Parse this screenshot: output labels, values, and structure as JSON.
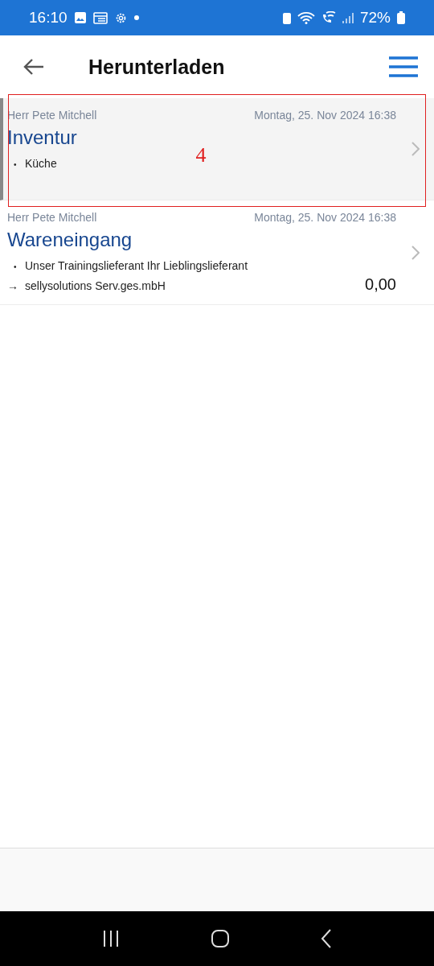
{
  "status_bar": {
    "time": "16:10",
    "battery": "72%"
  },
  "header": {
    "title": "Herunterladen"
  },
  "items": [
    {
      "selected": true,
      "author": "Herr Pete Mitchell",
      "date": "Montag, 25. Nov 2024 16:38",
      "title": "Inventur",
      "lines": [
        {
          "kind": "bullet",
          "marker": "•",
          "text": "Küche"
        }
      ]
    },
    {
      "selected": false,
      "author": "Herr Pete Mitchell",
      "date": "Montag, 25. Nov 2024 16:38",
      "title": "Wareneingang",
      "lines": [
        {
          "kind": "bullet",
          "marker": "•",
          "text": "Unser Trainingslieferant Ihr Lieblingslieferant"
        },
        {
          "kind": "arrow",
          "marker": "→",
          "text": "sellysolutions Serv.ges.mbH",
          "amount": "0,00"
        }
      ]
    }
  ],
  "annotation": {
    "label": "4"
  }
}
